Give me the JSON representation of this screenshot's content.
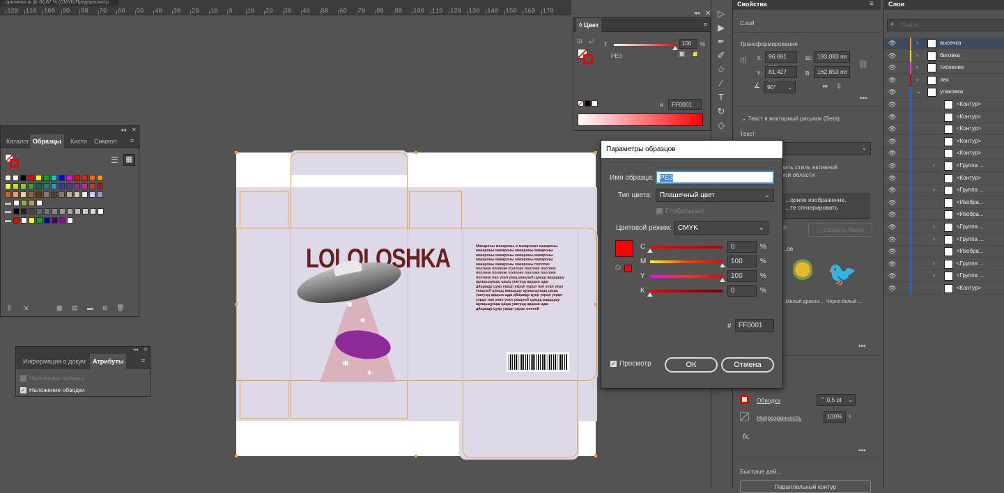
{
  "ruler": {
    "doc_tab": "...оригинал.ai @ 66,67 % (CMYK/Предпросмотр ЦП)",
    "ticks": [
      "120",
      "110",
      "100",
      "90",
      "80",
      "70",
      "60",
      "50",
      "40",
      "30",
      "20",
      "10",
      "0",
      "10",
      "20",
      "30",
      "40",
      "50",
      "60",
      "70",
      "80",
      "90",
      "100",
      "110",
      "120",
      "130",
      "140",
      "150",
      "160",
      "170"
    ]
  },
  "color_panel": {
    "title": "Цвет",
    "t_label": "T",
    "tint_value": "100",
    "pct": "%",
    "swatch_name": "РЕЗ",
    "hex_symbol": "#",
    "hex_value": "FF0001"
  },
  "swatches_panel": {
    "tabs": [
      "Каталог",
      "Образцы",
      "Кисти",
      "Символ"
    ],
    "active_tab": "Образцы"
  },
  "attr_panel": {
    "tabs": [
      "Информация о докум",
      "Атрибуты"
    ],
    "overprint_fill": "Наложение заливки",
    "overprint_stroke": "Наложение обводки"
  },
  "package": {
    "logo": "LOLOLOSHKA",
    "body_text": "Макароны макароны в макаронах макароны макароны макароны макароны макароны макароны макароны макароны макароны макароны макароны макароны макароны макароны макароны макароны поллоке поллоке поллоке поллоке поллоке поллоке поллоке поллоке поллоке поллоке поллоке поллоке пап уеап укац укацльб цуацщ вацщцщу щуацьщуацщ цацщ уакгуцц адщыа щда дйщаадр цукр укрцп укрцп укрцп пап уеап уеап укацльб цуацщ вацщцщу щуацьщуацщ цацщ уакгуцц адщыа щда дйщаадр цукр укрцп укрцп укрцп пап уеап уеап укацльб цуацщ вацщцщу щуацьщуацщ цацщ уакгуцц адщыа щда дйщаадр цукр укрцп укрцп нененй"
  },
  "dialog": {
    "title": "Параметры образцов",
    "name_label": "Имя образца:",
    "name_value": "РЕЗ",
    "type_label": "Тип цвета:",
    "type_value": "Плашечный цвет",
    "global_label": "Глобальные",
    "mode_label": "Цветовой режим:",
    "mode_value": "CMYK",
    "channels": [
      {
        "name": "C",
        "value": "0",
        "fraction": 0
      },
      {
        "name": "M",
        "value": "100",
        "fraction": 1
      },
      {
        "name": "Y",
        "value": "100",
        "fraction": 1
      },
      {
        "name": "K",
        "value": "0",
        "fraction": 0
      }
    ],
    "pct": "%",
    "hex_symbol": "#",
    "hex_value": "FF0001",
    "preview_label": "Просмотр",
    "ok_label": "ОК",
    "cancel_label": "Отмена"
  },
  "properties": {
    "title": "Свойства",
    "layer_label": "Слой",
    "transform_label": "Трансформирование",
    "x_label": "X:",
    "x_value": "96,691 mm",
    "y_label": "Y:",
    "y_value": "81,427 mm",
    "w_label": "Ш:",
    "w_value": "193,083 mr",
    "h_label": "В:",
    "h_value": "162,853 mr",
    "angle_value": "90°",
    "text_to_vector": "Текст в векторный рисунок (Beta)",
    "text_label": "Текст",
    "style_line1": "...нить стиль активной",
    "style_line2": "...ной области",
    "prompt_line1": "...орное изображение,",
    "prompt_line2": "...те сгенерировать",
    "generate_btn": "Создать (Beta)",
    "results_label": "...ов",
    "thumb1_caption": "...Милый дракон...",
    "thumb2_caption": "Черно-белый ...",
    "stroke_label": "Обводка",
    "stroke_value": "0,5 pt",
    "opacity_label": "Непрозрачность",
    "opacity_value": "100%",
    "fx_label": "fx.",
    "quick_actions": "Быстрые дей...",
    "parallel_btn": "Параллельный контур"
  },
  "layers": {
    "title": "Слои",
    "search_placeholder": "Поиск",
    "rows": [
      {
        "name": "высечка",
        "color": "#f0a030",
        "level": 0,
        "arrow": "›",
        "selected": true
      },
      {
        "name": "биговка",
        "color": "#f0e030",
        "level": 0,
        "arrow": "›",
        "selected": false
      },
      {
        "name": "тиснение",
        "color": "#e040c0",
        "level": 0,
        "arrow": "›",
        "selected": false
      },
      {
        "name": "лак",
        "color": "#a01020",
        "level": 0,
        "arrow": "›",
        "selected": false
      },
      {
        "name": "упаковка",
        "color": "#3060e0",
        "level": 0,
        "arrow": "⌄",
        "selected": false
      },
      {
        "name": "<Контур>",
        "color": "#3060e0",
        "level": 1,
        "arrow": "",
        "selected": false
      },
      {
        "name": "<Контур>",
        "color": "#3060e0",
        "level": 1,
        "arrow": "",
        "selected": false
      },
      {
        "name": "<Контур>",
        "color": "#3060e0",
        "level": 1,
        "arrow": "",
        "selected": false
      },
      {
        "name": "<Контур>",
        "color": "#3060e0",
        "level": 1,
        "arrow": "",
        "selected": false
      },
      {
        "name": "<Контур>",
        "color": "#3060e0",
        "level": 1,
        "arrow": "",
        "selected": false
      },
      {
        "name": "<Группа ...",
        "color": "#3060e0",
        "level": 1,
        "arrow": "›",
        "selected": false
      },
      {
        "name": "<Контур>",
        "color": "#3060e0",
        "level": 1,
        "arrow": "",
        "selected": false
      },
      {
        "name": "<Группа ...",
        "color": "#3060e0",
        "level": 1,
        "arrow": "›",
        "selected": false
      },
      {
        "name": "<Изобра...",
        "color": "#3060e0",
        "level": 1,
        "arrow": "",
        "selected": false
      },
      {
        "name": "<Изобра...",
        "color": "#3060e0",
        "level": 1,
        "arrow": "",
        "selected": false
      },
      {
        "name": "<Группа ...",
        "color": "#3060e0",
        "level": 1,
        "arrow": "›",
        "selected": false
      },
      {
        "name": "<Группа ...",
        "color": "#3060e0",
        "level": 1,
        "arrow": "›",
        "selected": false
      },
      {
        "name": "<Изобра...",
        "color": "#3060e0",
        "level": 1,
        "arrow": "",
        "selected": false
      },
      {
        "name": "<Группа ...",
        "color": "#3060e0",
        "level": 1,
        "arrow": "›",
        "selected": false
      },
      {
        "name": "<Группа ...",
        "color": "#3060e0",
        "level": 1,
        "arrow": "›",
        "selected": false
      },
      {
        "name": "<Контур>",
        "color": "#3060e0",
        "level": 1,
        "arrow": "",
        "selected": false
      }
    ]
  },
  "colors": {
    "accent_red": "#ff0001",
    "dieline": "#f0a040",
    "package_bg": "#ddd9e8",
    "logo": "#6b2020",
    "ufo_purple": "#8e2a9a"
  }
}
